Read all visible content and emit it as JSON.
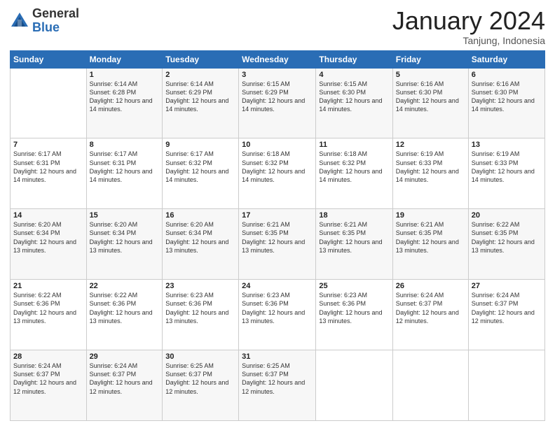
{
  "logo": {
    "general": "General",
    "blue": "Blue"
  },
  "header": {
    "month": "January 2024",
    "location": "Tanjung, Indonesia"
  },
  "days_of_week": [
    "Sunday",
    "Monday",
    "Tuesday",
    "Wednesday",
    "Thursday",
    "Friday",
    "Saturday"
  ],
  "weeks": [
    [
      {
        "day": "",
        "info": ""
      },
      {
        "day": "1",
        "info": "Sunrise: 6:14 AM\nSunset: 6:28 PM\nDaylight: 12 hours\nand 14 minutes."
      },
      {
        "day": "2",
        "info": "Sunrise: 6:14 AM\nSunset: 6:29 PM\nDaylight: 12 hours\nand 14 minutes."
      },
      {
        "day": "3",
        "info": "Sunrise: 6:15 AM\nSunset: 6:29 PM\nDaylight: 12 hours\nand 14 minutes."
      },
      {
        "day": "4",
        "info": "Sunrise: 6:15 AM\nSunset: 6:30 PM\nDaylight: 12 hours\nand 14 minutes."
      },
      {
        "day": "5",
        "info": "Sunrise: 6:16 AM\nSunset: 6:30 PM\nDaylight: 12 hours\nand 14 minutes."
      },
      {
        "day": "6",
        "info": "Sunrise: 6:16 AM\nSunset: 6:30 PM\nDaylight: 12 hours\nand 14 minutes."
      }
    ],
    [
      {
        "day": "7",
        "info": ""
      },
      {
        "day": "8",
        "info": "Sunrise: 6:17 AM\nSunset: 6:31 PM\nDaylight: 12 hours\nand 14 minutes."
      },
      {
        "day": "9",
        "info": "Sunrise: 6:17 AM\nSunset: 6:32 PM\nDaylight: 12 hours\nand 14 minutes."
      },
      {
        "day": "10",
        "info": "Sunrise: 6:18 AM\nSunset: 6:32 PM\nDaylight: 12 hours\nand 14 minutes."
      },
      {
        "day": "11",
        "info": "Sunrise: 6:18 AM\nSunset: 6:32 PM\nDaylight: 12 hours\nand 14 minutes."
      },
      {
        "day": "12",
        "info": "Sunrise: 6:19 AM\nSunset: 6:33 PM\nDaylight: 12 hours\nand 14 minutes."
      },
      {
        "day": "13",
        "info": "Sunrise: 6:19 AM\nSunset: 6:33 PM\nDaylight: 12 hours\nand 14 minutes."
      }
    ],
    [
      {
        "day": "14",
        "info": ""
      },
      {
        "day": "15",
        "info": "Sunrise: 6:20 AM\nSunset: 6:34 PM\nDaylight: 12 hours\nand 13 minutes."
      },
      {
        "day": "16",
        "info": "Sunrise: 6:20 AM\nSunset: 6:34 PM\nDaylight: 12 hours\nand 13 minutes."
      },
      {
        "day": "17",
        "info": "Sunrise: 6:21 AM\nSunset: 6:35 PM\nDaylight: 12 hours\nand 13 minutes."
      },
      {
        "day": "18",
        "info": "Sunrise: 6:21 AM\nSunset: 6:35 PM\nDaylight: 12 hours\nand 13 minutes."
      },
      {
        "day": "19",
        "info": "Sunrise: 6:21 AM\nSunset: 6:35 PM\nDaylight: 12 hours\nand 13 minutes."
      },
      {
        "day": "20",
        "info": "Sunrise: 6:22 AM\nSunset: 6:35 PM\nDaylight: 12 hours\nand 13 minutes."
      }
    ],
    [
      {
        "day": "21",
        "info": ""
      },
      {
        "day": "22",
        "info": "Sunrise: 6:22 AM\nSunset: 6:36 PM\nDaylight: 12 hours\nand 13 minutes."
      },
      {
        "day": "23",
        "info": "Sunrise: 6:23 AM\nSunset: 6:36 PM\nDaylight: 12 hours\nand 13 minutes."
      },
      {
        "day": "24",
        "info": "Sunrise: 6:23 AM\nSunset: 6:36 PM\nDaylight: 12 hours\nand 13 minutes."
      },
      {
        "day": "25",
        "info": "Sunrise: 6:23 AM\nSunset: 6:36 PM\nDaylight: 12 hours\nand 13 minutes."
      },
      {
        "day": "26",
        "info": "Sunrise: 6:24 AM\nSunset: 6:37 PM\nDaylight: 12 hours\nand 12 minutes."
      },
      {
        "day": "27",
        "info": "Sunrise: 6:24 AM\nSunset: 6:37 PM\nDaylight: 12 hours\nand 12 minutes."
      }
    ],
    [
      {
        "day": "28",
        "info": "Sunrise: 6:24 AM\nSunset: 6:37 PM\nDaylight: 12 hours\nand 12 minutes."
      },
      {
        "day": "29",
        "info": "Sunrise: 6:24 AM\nSunset: 6:37 PM\nDaylight: 12 hours\nand 12 minutes."
      },
      {
        "day": "30",
        "info": "Sunrise: 6:25 AM\nSunset: 6:37 PM\nDaylight: 12 hours\nand 12 minutes."
      },
      {
        "day": "31",
        "info": "Sunrise: 6:25 AM\nSunset: 6:37 PM\nDaylight: 12 hours\nand 12 minutes."
      },
      {
        "day": "",
        "info": ""
      },
      {
        "day": "",
        "info": ""
      },
      {
        "day": "",
        "info": ""
      }
    ]
  ]
}
